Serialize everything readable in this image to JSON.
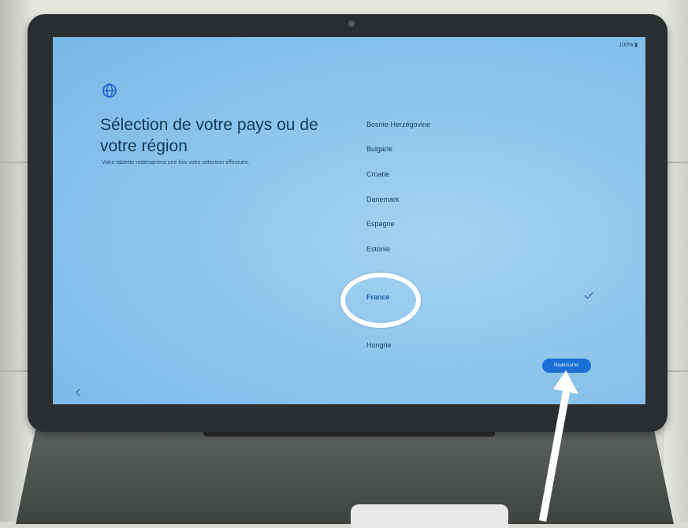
{
  "status_bar": {
    "battery": "100% ▮"
  },
  "header": {
    "icon": "globe-icon",
    "title": "Sélection de votre pays ou de votre région",
    "subtitle": "Votre tablette redémarrera une fois votre sélection effectuée."
  },
  "countries": [
    {
      "label": "Bosnie-Herzégovine",
      "selected": false
    },
    {
      "label": "Bulgarie",
      "selected": false
    },
    {
      "label": "Croatie",
      "selected": false
    },
    {
      "label": "Danemark",
      "selected": false
    },
    {
      "label": "Espagne",
      "selected": false
    },
    {
      "label": "Estonie",
      "selected": false
    },
    {
      "label": "France",
      "selected": true
    },
    {
      "label": "Hongrie",
      "selected": false
    }
  ],
  "icons": {
    "selected_mark": "check-icon",
    "back": "back-arrow-icon"
  },
  "actions": {
    "restart_label": "Redémarrer"
  },
  "colors": {
    "screen_bg": "#8fc6ec",
    "accent": "#1a6fd6",
    "annotation": "#ffffff"
  }
}
